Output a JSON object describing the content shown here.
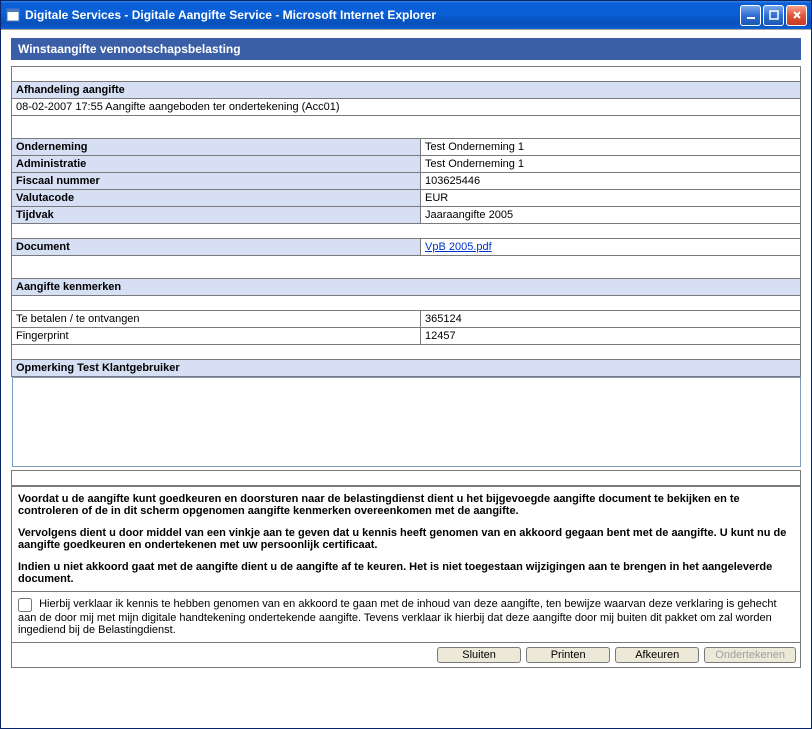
{
  "window": {
    "title": "Digitale Services - Digitale Aangifte Service - Microsoft Internet Explorer"
  },
  "page": {
    "title": "Winstaangifte vennootschapsbelasting"
  },
  "afhandeling": {
    "header": "Afhandeling aangifte",
    "status": "08-02-2007 17:55 Aangifte aangeboden ter ondertekening (Acc01)"
  },
  "onderneming": {
    "labels": {
      "onderneming": "Onderneming",
      "administratie": "Administratie",
      "fiscaal_nummer": "Fiscaal nummer",
      "valutacode": "Valutacode",
      "tijdvak": "Tijdvak"
    },
    "values": {
      "onderneming": "Test Onderneming 1",
      "administratie": "Test Onderneming 1",
      "fiscaal_nummer": "103625446",
      "valutacode": "EUR",
      "tijdvak": "Jaaraangifte 2005"
    }
  },
  "document": {
    "label": "Document",
    "link_text": "VpB 2005.pdf"
  },
  "kenmerken": {
    "header": "Aangifte kenmerken",
    "labels": {
      "te_betalen": "Te betalen / te ontvangen",
      "fingerprint": "Fingerprint"
    },
    "values": {
      "te_betalen": "365124",
      "fingerprint": "12457"
    }
  },
  "opmerking": {
    "header": "Opmerking Test Klantgebruiker",
    "value": ""
  },
  "instructions": {
    "p1": "Voordat u de aangifte kunt goedkeuren en doorsturen naar de belastingdienst dient u het bijgevoegde aangifte document te bekijken en te controleren of de in dit scherm opgenomen aangifte kenmerken overeenkomen met de aangifte.",
    "p2": "Vervolgens dient u door middel van een vinkje aan te geven dat u kennis heeft genomen van en akkoord gegaan bent met de aangifte. U kunt nu de aangifte goedkeuren en ondertekenen met uw persoonlijk certificaat.",
    "p3": "Indien u niet akkoord gaat met de aangifte dient u de aangifte af te keuren. Het is niet toegestaan wijzigingen aan te brengen in het aangeleverde document."
  },
  "agree": {
    "text": "Hierbij verklaar ik kennis te hebben genomen van en akkoord te gaan met de inhoud van deze aangifte, ten bewijze waarvan deze verklaring is gehecht aan de door mij met mijn digitale handtekening ondertekende aangifte. Tevens verklaar ik hierbij dat deze aangifte door mij buiten dit pakket om zal worden ingediend bij de Belastingdienst."
  },
  "buttons": {
    "sluiten": "Sluiten",
    "printen": "Printen",
    "afkeuren": "Afkeuren",
    "ondertekenen": "Ondertekenen"
  }
}
